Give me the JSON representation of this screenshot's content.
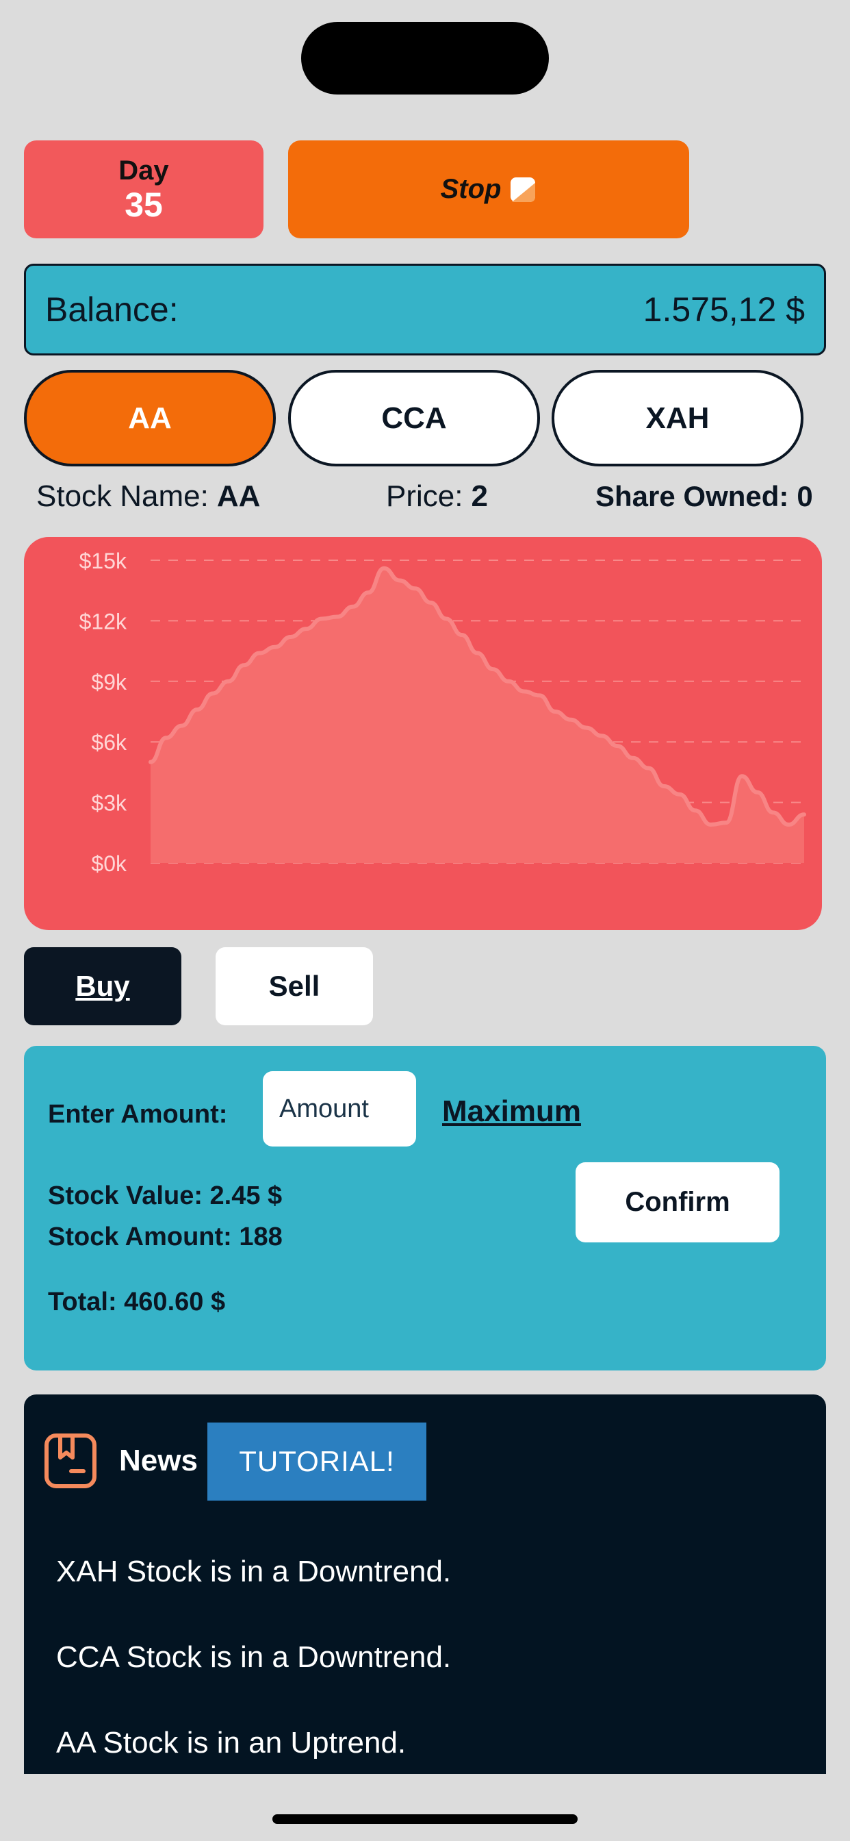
{
  "header": {
    "day_label": "Day",
    "day_value": "35",
    "stop_label": "Stop"
  },
  "balance": {
    "label": "Balance:",
    "value": "1.575,12 $"
  },
  "tabs": [
    {
      "label": "AA",
      "active": true
    },
    {
      "label": "CCA",
      "active": false
    },
    {
      "label": "XAH",
      "active": false
    }
  ],
  "stock_info": {
    "name_label": "Stock Name:",
    "name_value": "AA",
    "price_label": "Price:",
    "price_value": "2",
    "shares_label": "Share Owned:",
    "shares_value": "0"
  },
  "chart_data": {
    "type": "area",
    "ytick_labels": [
      "$15k",
      "$12k",
      "$9k",
      "$6k",
      "$3k",
      "$0k"
    ],
    "ylim": [
      0,
      15000
    ],
    "grid": true,
    "values": [
      5000,
      6200,
      6800,
      7600,
      8400,
      9000,
      9800,
      10400,
      10700,
      11200,
      11600,
      12100,
      12200,
      12700,
      13400,
      14600,
      14000,
      13600,
      12900,
      12100,
      11300,
      10400,
      9600,
      9000,
      8500,
      8300,
      7500,
      7100,
      6700,
      6300,
      5800,
      5200,
      4700,
      3800,
      3400,
      2600,
      1900,
      2000,
      4300,
      3500,
      2500,
      1900,
      2400
    ],
    "colors": {
      "background": "#f2545a",
      "fill": "#f56d6d",
      "line": "#f88585"
    }
  },
  "trade": {
    "buy_label": "Buy",
    "sell_label": "Sell",
    "enter_amount_label": "Enter Amount:",
    "amount_placeholder": "Amount",
    "maximum_label": "Maximum",
    "stock_value": "Stock Value: 2.45 $",
    "stock_amount": "Stock Amount: 188",
    "total": "Total: 460.60 $",
    "confirm_label": "Confirm"
  },
  "news": {
    "title": "News",
    "tutorial_label": "TUTORIAL!",
    "items": [
      "XAH Stock is in a Downtrend.",
      "CCA Stock is in a Downtrend.",
      "AA Stock is in an Uptrend."
    ]
  },
  "colors": {
    "accent_orange": "#f36c0a",
    "accent_red": "#f2595b",
    "teal": "#36b3c8",
    "navy": "#0b1623",
    "tutorial_blue": "#2b7fc0"
  }
}
